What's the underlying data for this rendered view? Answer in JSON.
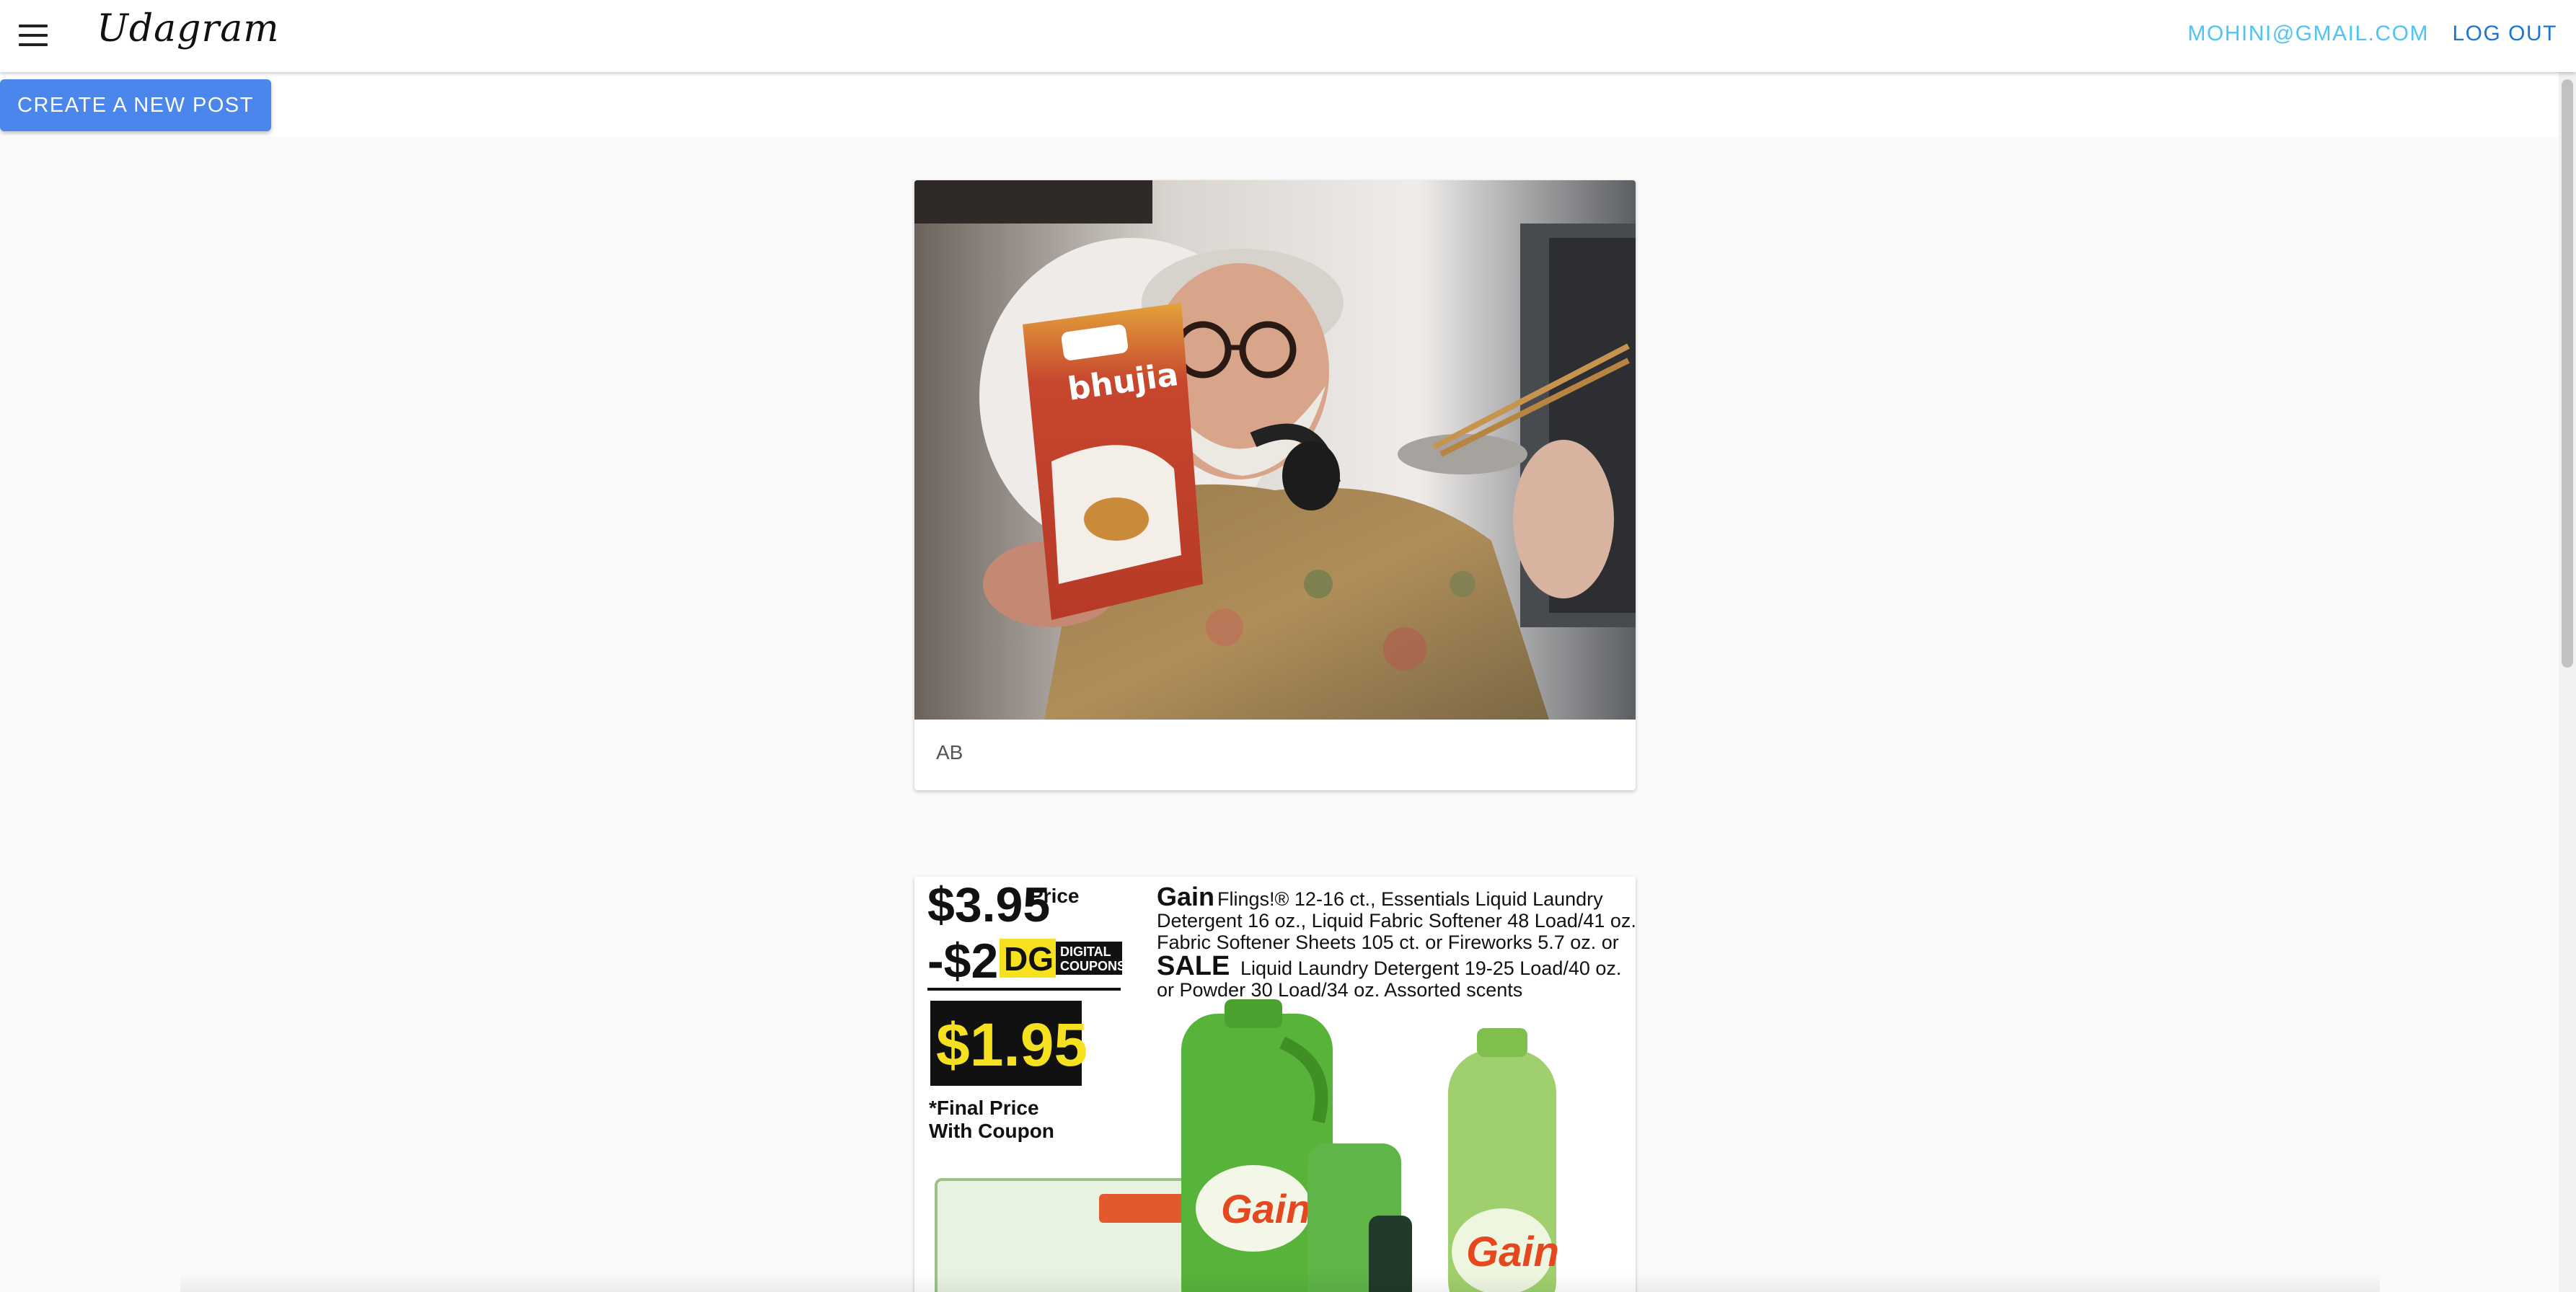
{
  "appbar": {
    "brand": "Udagram",
    "user_email": "MOHINI@GMAIL.COM",
    "logout_label": "LOG OUT",
    "menu_icon": "hamburger-menu-icon"
  },
  "actions": {
    "create_post_label": "CREATE A NEW POST"
  },
  "feed": {
    "posts": [
      {
        "caption": "AB"
      },
      {
        "caption": "",
        "ad": {
          "price": "$3.95",
          "price_label": "Price",
          "coupon": "-$2",
          "coupon_brand": "DG",
          "coupon_type_1": "DIGITAL",
          "coupon_type_2": "COUPONS",
          "final_price": "$1.95",
          "final_label_1": "*Final Price",
          "final_label_2": "With Coupon",
          "brand": "Gain",
          "line1": "Flings!® 12-16 ct., Essentials Liquid Laundry",
          "line2": "Detergent 16 oz., Liquid Fabric Softener 48 Load/41 oz.,",
          "line3": "Fabric Softener Sheets 105 ct. or Fireworks 5.7 oz. or",
          "sale": "SALE",
          "line4": "Liquid Laundry Detergent 19-25 Load/40 oz.",
          "line5": "or Powder 30 Load/34 oz. Assorted scents",
          "bottle_brand": "Gain"
        }
      }
    ]
  },
  "colors": {
    "email": "#4fc3f7",
    "logout": "#1976d2",
    "button": "#4a86ec"
  }
}
